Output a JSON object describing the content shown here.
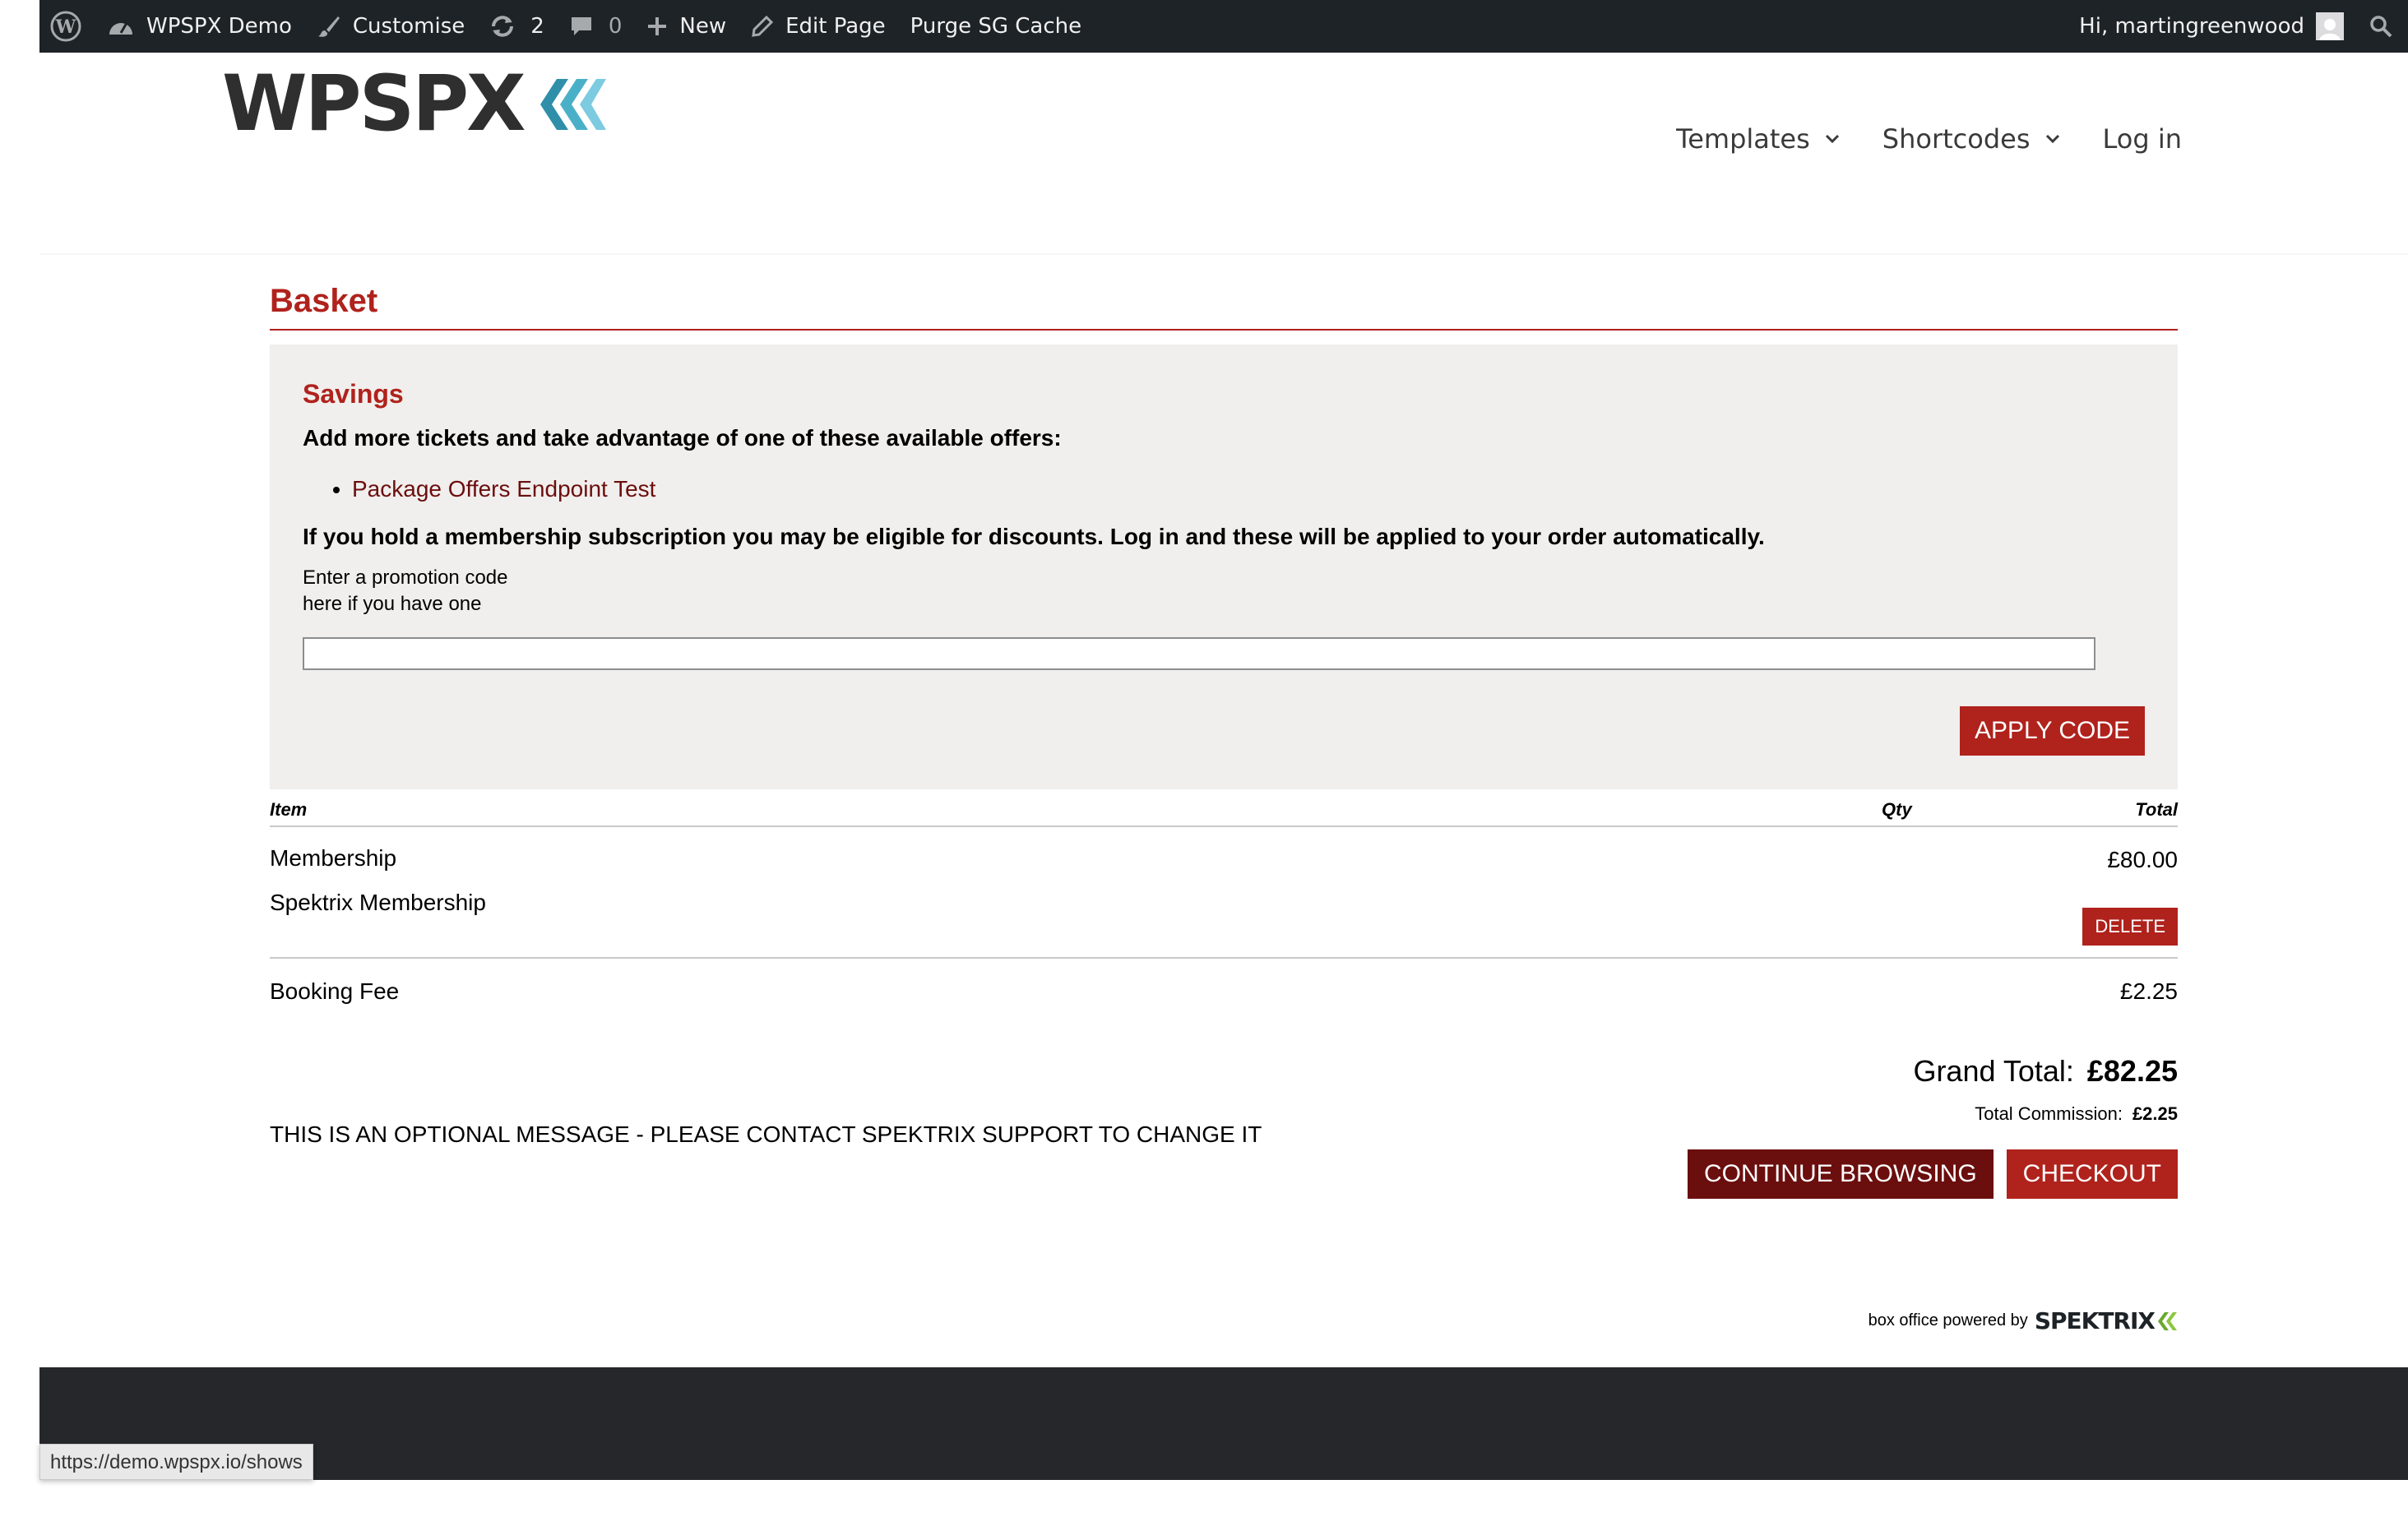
{
  "adminbar": {
    "site_name": "WPSPX Demo",
    "customise": "Customise",
    "updates_count": "2",
    "comments_count": "0",
    "new_label": "New",
    "edit_page": "Edit Page",
    "purge_cache": "Purge SG Cache",
    "greeting": "Hi, martingreenwood"
  },
  "header": {
    "logo_text": "WPSPX",
    "nav": [
      {
        "label": "Templates",
        "has_dropdown": true
      },
      {
        "label": "Shortcodes",
        "has_dropdown": true
      },
      {
        "label": "Log in",
        "has_dropdown": false
      }
    ]
  },
  "basket": {
    "title": "Basket",
    "savings": {
      "heading": "Savings",
      "offers_heading": "Add more tickets and take advantage of one of these available offers:",
      "offers": [
        "Package Offers Endpoint Test"
      ],
      "membership_note": "If you hold a membership subscription you may be eligible for discounts. Log in and these will be applied to your order automatically.",
      "promo_label": "Enter a promotion code here if you have one",
      "promo_value": "",
      "apply_label": "APPLY CODE"
    },
    "table": {
      "col_item": "Item",
      "col_qty": "Qty",
      "col_total": "Total",
      "items": [
        {
          "name": "Membership",
          "sub": "Spektrix Membership",
          "price": "£80.00",
          "delete_label": "DELETE"
        }
      ],
      "fee": {
        "name": "Booking Fee",
        "price": "£2.25"
      }
    },
    "totals": {
      "grand_label": "Grand Total:",
      "grand_value": "£82.25",
      "commission_label": "Total Commission:",
      "commission_value": "£2.25"
    },
    "optional_message": "THIS IS AN OPTIONAL MESSAGE - PLEASE CONTACT SPEKTRIX SUPPORT TO CHANGE IT",
    "continue_label": "CONTINUE BROWSING",
    "checkout_label": "CHECKOUT"
  },
  "powered": {
    "text": "box office powered by",
    "brand": "SPEKTRIX"
  },
  "status_url": "https://demo.wpspx.io/shows",
  "colors": {
    "accent": "#b0221c",
    "dark_accent": "#6b0e0e",
    "adminbar_bg": "#1d2327",
    "savings_bg": "#f0efed",
    "logo_chevrons": "#4ab0c8",
    "spektrix_green": "#8cc63f"
  }
}
